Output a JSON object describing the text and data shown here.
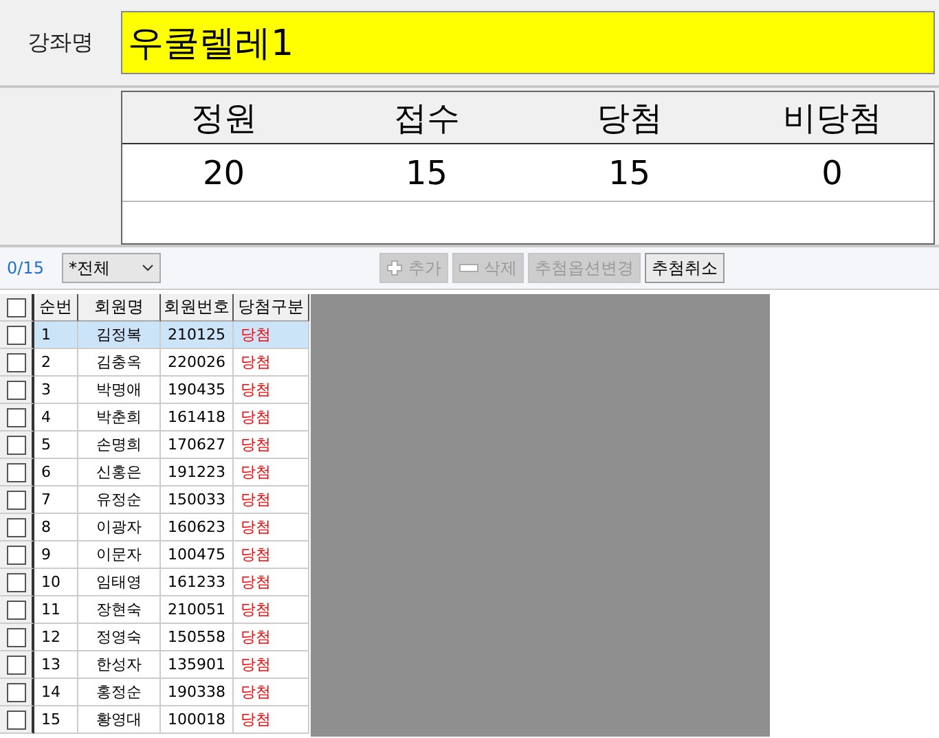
{
  "course": {
    "label": "강좌명",
    "value": "우쿨렐레1"
  },
  "summary": {
    "columns": [
      "정원",
      "접수",
      "당첨",
      "비당첨"
    ],
    "values": [
      "20",
      "15",
      "15",
      "0"
    ]
  },
  "toolbar": {
    "count": "0/15",
    "filter": {
      "value": "*전체"
    },
    "buttons": [
      {
        "label": "추가",
        "kind": "plus",
        "disabled": true
      },
      {
        "label": "삭제",
        "kind": "minus",
        "disabled": true
      },
      {
        "label": "추첨옵션변경",
        "kind": "text",
        "disabled": true
      },
      {
        "label": "추첨취소",
        "kind": "text",
        "disabled": false
      }
    ]
  },
  "table": {
    "select_all": {
      "checked": false
    },
    "columns": [
      "순번",
      "회원명",
      "회원번호",
      "당첨구분"
    ],
    "rows": [
      {
        "no": "1",
        "name": "김정복",
        "member_id": "210125",
        "result": "당첨",
        "checked": false,
        "selected": true
      },
      {
        "no": "2",
        "name": "김충옥",
        "member_id": "220026",
        "result": "당첨",
        "checked": false,
        "selected": false
      },
      {
        "no": "3",
        "name": "박명애",
        "member_id": "190435",
        "result": "당첨",
        "checked": false,
        "selected": false
      },
      {
        "no": "4",
        "name": "박춘희",
        "member_id": "161418",
        "result": "당첨",
        "checked": false,
        "selected": false
      },
      {
        "no": "5",
        "name": "손명희",
        "member_id": "170627",
        "result": "당첨",
        "checked": false,
        "selected": false
      },
      {
        "no": "6",
        "name": "신홍은",
        "member_id": "191223",
        "result": "당첨",
        "checked": false,
        "selected": false
      },
      {
        "no": "7",
        "name": "유정순",
        "member_id": "150033",
        "result": "당첨",
        "checked": false,
        "selected": false
      },
      {
        "no": "8",
        "name": "이광자",
        "member_id": "160623",
        "result": "당첨",
        "checked": false,
        "selected": false
      },
      {
        "no": "9",
        "name": "이문자",
        "member_id": "100475",
        "result": "당첨",
        "checked": false,
        "selected": false
      },
      {
        "no": "10",
        "name": "임태영",
        "member_id": "161233",
        "result": "당첨",
        "checked": false,
        "selected": false
      },
      {
        "no": "11",
        "name": "장현숙",
        "member_id": "210051",
        "result": "당첨",
        "checked": false,
        "selected": false
      },
      {
        "no": "12",
        "name": "정영숙",
        "member_id": "150558",
        "result": "당첨",
        "checked": false,
        "selected": false
      },
      {
        "no": "13",
        "name": "한성자",
        "member_id": "135901",
        "result": "당첨",
        "checked": false,
        "selected": false
      },
      {
        "no": "14",
        "name": "홍정순",
        "member_id": "190338",
        "result": "당첨",
        "checked": false,
        "selected": false
      },
      {
        "no": "15",
        "name": "황영대",
        "member_id": "100018",
        "result": "당첨",
        "checked": false,
        "selected": false
      }
    ]
  }
}
